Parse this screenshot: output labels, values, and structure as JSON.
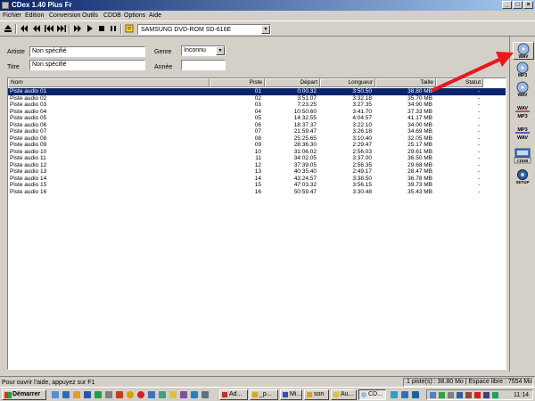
{
  "window": {
    "title": "CDex 1.40 Plus Fr"
  },
  "menu": [
    "Fichier",
    "Edition",
    "Conversion",
    "Outils",
    "CDDB",
    "Options",
    "Aide"
  ],
  "toolbar": {
    "drive": "SAMSUNG DVD-ROM SD-616E",
    "icons": [
      "eject-icon",
      "previous-track-icon",
      "rewind-icon",
      "fast-forward-icon",
      "next-track-icon",
      "skip-icon",
      "play-icon",
      "stop-icon",
      "pause-icon",
      "cd-info-icon"
    ]
  },
  "form": {
    "artist_label": "Artiste",
    "artist_value": "Non spécifié",
    "title_label": "Titre",
    "title_value": "Non spécifié",
    "genre_label": "Genre",
    "genre_value": "Inconnu",
    "year_label": "Année",
    "year_value": ""
  },
  "tracklist": {
    "columns": [
      "Nom",
      "Piste",
      "Départ",
      "Longueur",
      "Taille",
      "Statut"
    ],
    "rows": [
      {
        "name": "Piste audio 01",
        "track": "01",
        "start": "0:00.32",
        "length": "3:50.50",
        "size": "38.80 MB",
        "status": "-",
        "selected": true
      },
      {
        "name": "Piste audio 02",
        "track": "02",
        "start": "3:51.07",
        "length": "3:32.18",
        "size": "35.70 MB",
        "status": "-"
      },
      {
        "name": "Piste audio 03",
        "track": "03",
        "start": "7:23.25",
        "length": "3:27.35",
        "size": "34.90 MB",
        "status": "-"
      },
      {
        "name": "Piste audio 04",
        "track": "04",
        "start": "10:50.60",
        "length": "3:41.70",
        "size": "37.33 MB",
        "status": "-"
      },
      {
        "name": "Piste audio 05",
        "track": "05",
        "start": "14:32.55",
        "length": "4:04.57",
        "size": "41.17 MB",
        "status": "-"
      },
      {
        "name": "Piste audio 06",
        "track": "06",
        "start": "18:37.37",
        "length": "3:22.10",
        "size": "34.00 MB",
        "status": "-"
      },
      {
        "name": "Piste audio 07",
        "track": "07",
        "start": "21:59.47",
        "length": "3:26.18",
        "size": "34.69 MB",
        "status": "-"
      },
      {
        "name": "Piste audio 08",
        "track": "08",
        "start": "25:25.65",
        "length": "3:10.40",
        "size": "32.05 MB",
        "status": "-"
      },
      {
        "name": "Piste audio 09",
        "track": "09",
        "start": "28:36.30",
        "length": "2:29.47",
        "size": "25.17 MB",
        "status": "-"
      },
      {
        "name": "Piste audio 10",
        "track": "10",
        "start": "31:06.02",
        "length": "2:56.03",
        "size": "29.61 MB",
        "status": "-"
      },
      {
        "name": "Piste audio 11",
        "track": "11",
        "start": "34:02.05",
        "length": "3:37.00",
        "size": "36.50 MB",
        "status": "-"
      },
      {
        "name": "Piste audio 12",
        "track": "12",
        "start": "37:39.05",
        "length": "2:56.35",
        "size": "29.68 MB",
        "status": "-"
      },
      {
        "name": "Piste audio 13",
        "track": "13",
        "start": "40:35.40",
        "length": "2:49.17",
        "size": "28.47 MB",
        "status": "-"
      },
      {
        "name": "Piste audio 14",
        "track": "14",
        "start": "43:24.57",
        "length": "3:38.50",
        "size": "36.78 MB",
        "status": "-"
      },
      {
        "name": "Piste audio 15",
        "track": "15",
        "start": "47:03.32",
        "length": "3:56.15",
        "size": "39.73 MB",
        "status": "-"
      },
      {
        "name": "Piste audio 16",
        "track": "16",
        "start": "50:59.47",
        "length": "3:30.48",
        "size": "35.43 MB",
        "status": "-"
      }
    ]
  },
  "sidebar": {
    "buttons": [
      {
        "name": "cd-to-wav-button",
        "text": "WAV"
      },
      {
        "name": "cd-to-mp3-button",
        "text": "MP3"
      },
      {
        "name": "tracks-to-wav-button",
        "text": "WAV"
      },
      {
        "name": "wav-to-mp3-button",
        "text": "WAV MP3"
      },
      {
        "name": "mp3-to-wav-button",
        "text": "MP3 WAV"
      },
      {
        "name": "cddb-button",
        "text": "CDDB"
      },
      {
        "name": "setup-button",
        "text": "SETUP"
      }
    ]
  },
  "status": {
    "help": "Pour ouvrir l'aide, appuyez sur F1",
    "info": "1 piste(s) : 38.80 Mo | Espace libre : 7554 Mo"
  },
  "taskbar": {
    "start": "Démarrer",
    "tasks": [
      "Ad...",
      "_p...",
      "Mi...",
      "son",
      "Au...",
      "CD..."
    ],
    "clock": "11:14"
  },
  "colors": {
    "title_start": "#0a246a",
    "title_end": "#a6caf0",
    "selection": "#0a246a",
    "arrow": "#e8181c",
    "face": "#d4d0c8"
  }
}
